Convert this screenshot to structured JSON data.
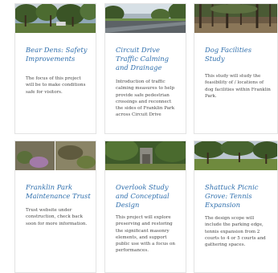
{
  "cards": [
    {
      "title": "Bear Dens: Safety Improvements",
      "description": "The focus of this project will be to make conditions safe for visitors.",
      "photo_icon": "park-trees-photo"
    },
    {
      "title": "Circuit Drive Traffic Calming and Drainage",
      "description": "Introduction of traffic calming measures to help provide safe pedestrian crossings and reconnect the sides of Franklin Park across Circuit Drive",
      "photo_icon": "road-photo"
    },
    {
      "title": "Dog Facilities Study",
      "description": "This study will study the feasibility of / locations of dog facilities within Franklin Park.",
      "photo_icon": "forest-clearing-photo"
    },
    {
      "title": "Franklin Park Maintenance Trust",
      "description": "Trust website under construction, check back soon for more information.",
      "photo_icon": "garden-photo"
    },
    {
      "title": "Overlook Study and Conceptual Design",
      "description": "This project will explore preserving and restoring the significant masonry elements, and support public use with a focus on performances.",
      "photo_icon": "stone-ruins-photo"
    },
    {
      "title": "Shattuck Picnic Grove: Tennis Expansion",
      "description": "The design scope will include the parking edge, tennis expansion from 2 courts to 4 or 5 courts and gathering spaces.",
      "photo_icon": "picnic-grove-photo"
    }
  ],
  "colors": {
    "title": "#2f6fad",
    "text": "#4a4a4a",
    "border": "#e3e3e3"
  }
}
